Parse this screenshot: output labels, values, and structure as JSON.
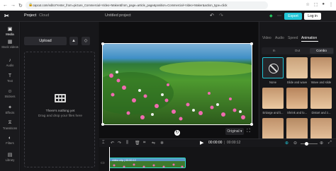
{
  "browser": {
    "url": "capcut.com/editor?enter_from=picture_Commercial+Video+Maker&from_page=article_page&position=Commercial+Video+Maker&action_type=click",
    "nav": [
      "←",
      "→",
      "↻"
    ]
  },
  "header": {
    "tabs": [
      "Project",
      "Cloud"
    ],
    "project_title": "Untitled project",
    "export_label": "Export",
    "login_label": "Log in"
  },
  "sidebar": {
    "items": [
      {
        "icon": "media-icon",
        "glyph": "▣",
        "label": "Media"
      },
      {
        "icon": "stock-videos-icon",
        "glyph": "▦",
        "label": "Stock videos"
      },
      {
        "icon": "audio-icon",
        "glyph": "♪",
        "label": "Audio"
      },
      {
        "icon": "text-icon",
        "glyph": "T",
        "label": "Text"
      },
      {
        "icon": "stickers-icon",
        "glyph": "☺",
        "label": "Stickers"
      },
      {
        "icon": "effects-icon",
        "glyph": "✦",
        "label": "Effects"
      },
      {
        "icon": "transitions-icon",
        "glyph": "⧖",
        "label": "Transitions"
      },
      {
        "icon": "filters-icon",
        "glyph": "◐",
        "label": "Filters"
      },
      {
        "icon": "library-icon",
        "glyph": "▤",
        "label": "Library"
      }
    ]
  },
  "media": {
    "upload_label": "Upload",
    "empty_title": "There's nothing yet",
    "empty_hint": "Drag and drop your files here"
  },
  "player": {
    "ratio_label": "Original",
    "current_time": "00:00:00",
    "total_time": "00:00:12"
  },
  "right_panel": {
    "tabs": [
      "Video",
      "Audio",
      "Speed",
      "Animation"
    ],
    "active_tab": "Animation",
    "sub_tabs": [
      "In",
      "Out",
      "Combo"
    ],
    "active_sub_tab": "Combo",
    "animations": [
      "None",
      "Slide and wave",
      "Wave and slide",
      "Enlarge and li...",
      "Shrink and lo...",
      "Distort and z..."
    ]
  },
  "timeline": {
    "clip_label": "video clip | 00:00:12",
    "accent": "#2ee0c9"
  },
  "colors": {
    "accent": "#22c5d6",
    "selection": "#2ee0c9",
    "active_anim_border": "#22c5d6"
  }
}
